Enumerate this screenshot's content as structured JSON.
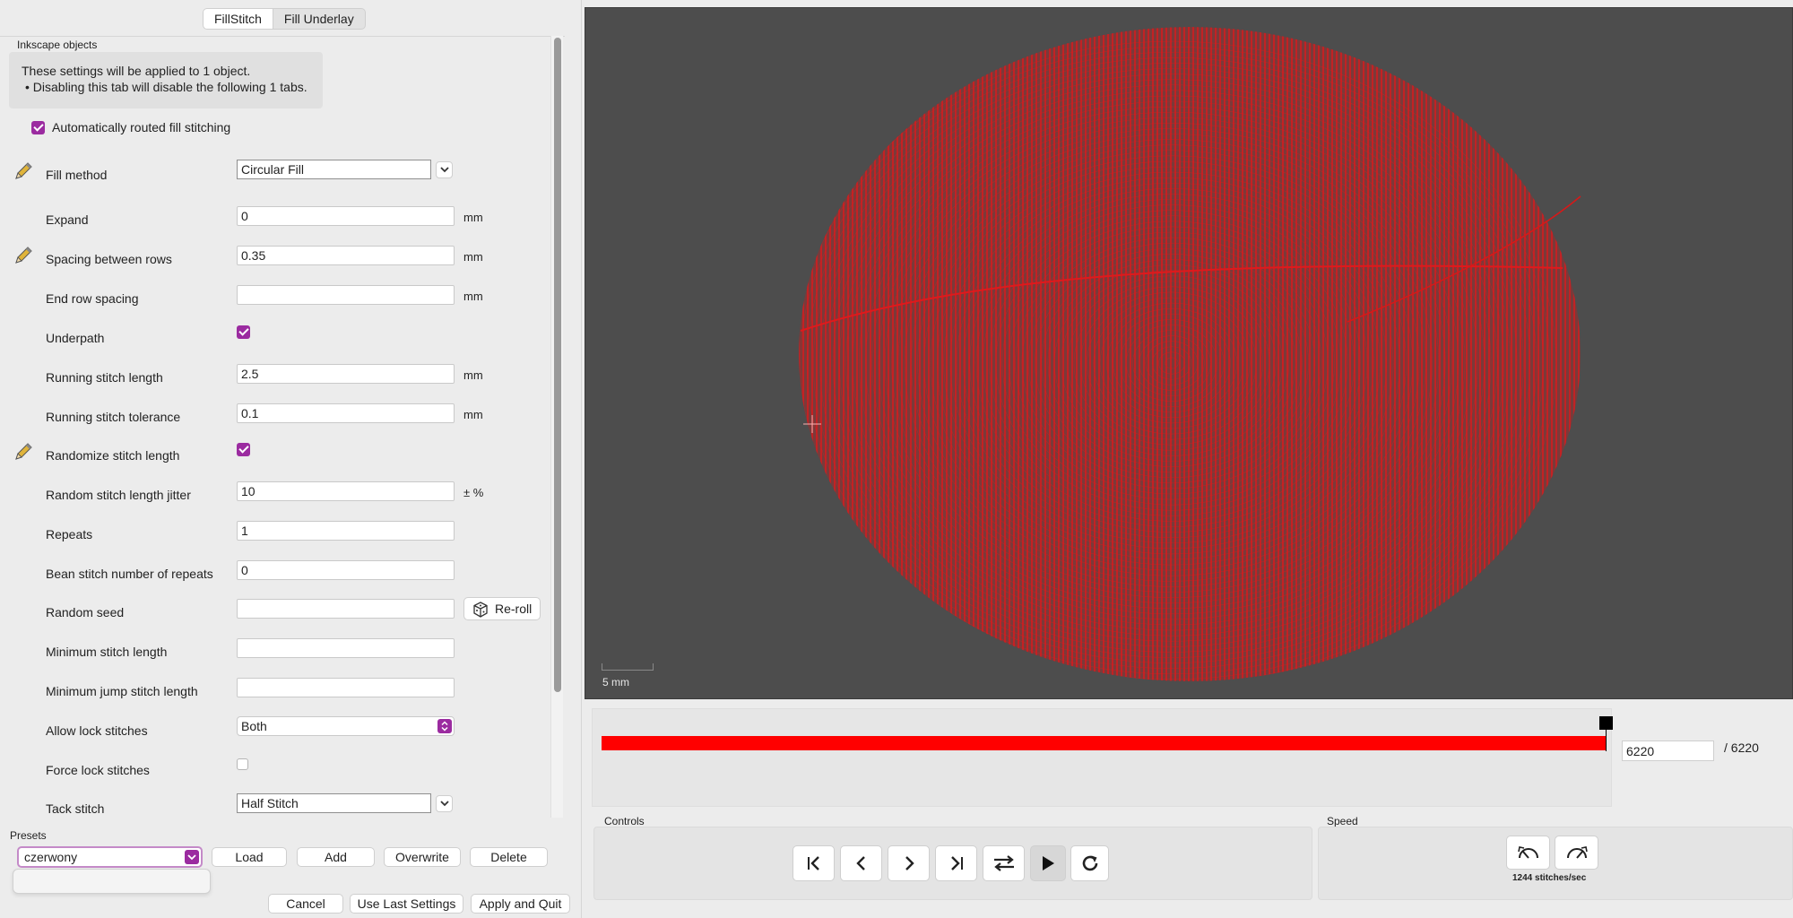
{
  "tabs": [
    {
      "label": "FillStitch",
      "active": true
    },
    {
      "label": "Fill Underlay",
      "active": false
    }
  ],
  "object_group": {
    "title": "Inkscape objects",
    "info_line1": "These settings will be applied to 1 object.",
    "info_line2": "• Disabling this tab will disable the following 1 tabs."
  },
  "auto_route": {
    "label": "Automatically routed fill stitching",
    "checked": true
  },
  "params": {
    "fill_method": {
      "label": "Fill method",
      "value": "Circular Fill"
    },
    "expand": {
      "label": "Expand",
      "value": "0",
      "unit": "mm"
    },
    "row_spacing": {
      "label": "Spacing between rows",
      "value": "0.35",
      "unit": "mm"
    },
    "end_row_spacing": {
      "label": "End row spacing",
      "value": "",
      "unit": "mm"
    },
    "underpath": {
      "label": "Underpath",
      "checked": true
    },
    "running_stitch_length": {
      "label": "Running stitch length",
      "value": "2.5",
      "unit": "mm"
    },
    "running_stitch_tolerance": {
      "label": "Running stitch tolerance",
      "value": "0.1",
      "unit": "mm"
    },
    "randomize": {
      "label": "Randomize stitch length",
      "checked": true
    },
    "jitter": {
      "label": "Random stitch length jitter",
      "value": "10",
      "unit": "± %"
    },
    "repeats": {
      "label": "Repeats",
      "value": "1"
    },
    "bean": {
      "label": "Bean stitch number of repeats",
      "value": "0"
    },
    "seed": {
      "label": "Random seed",
      "value": "",
      "button": "Re-roll"
    },
    "min_stitch": {
      "label": "Minimum stitch length",
      "value": ""
    },
    "min_jump": {
      "label": "Minimum jump stitch length",
      "value": ""
    },
    "allow_lock": {
      "label": "Allow lock stitches",
      "value": "Both"
    },
    "force_lock": {
      "label": "Force lock stitches",
      "checked": false
    },
    "tack": {
      "label": "Tack stitch",
      "value": "Half Stitch"
    }
  },
  "presets": {
    "label": "Presets",
    "value": "czerwony",
    "load": "Load",
    "add": "Add",
    "overwrite": "Overwrite",
    "delete": "Delete"
  },
  "footer": {
    "cancel": "Cancel",
    "use_last": "Use Last Settings",
    "apply_quit": "Apply and Quit"
  },
  "preview": {
    "scale_label": "5 mm",
    "stitch_current": "6220",
    "stitch_total": "/ 6220",
    "progress_fraction": 1.0,
    "stitch_color": "#e0191c",
    "background_color": "#4d4d4d"
  },
  "controls": {
    "label": "Controls"
  },
  "speed": {
    "label": "Speed",
    "value": "1244 stitches/sec"
  },
  "accent_color": "#9b2ba0"
}
